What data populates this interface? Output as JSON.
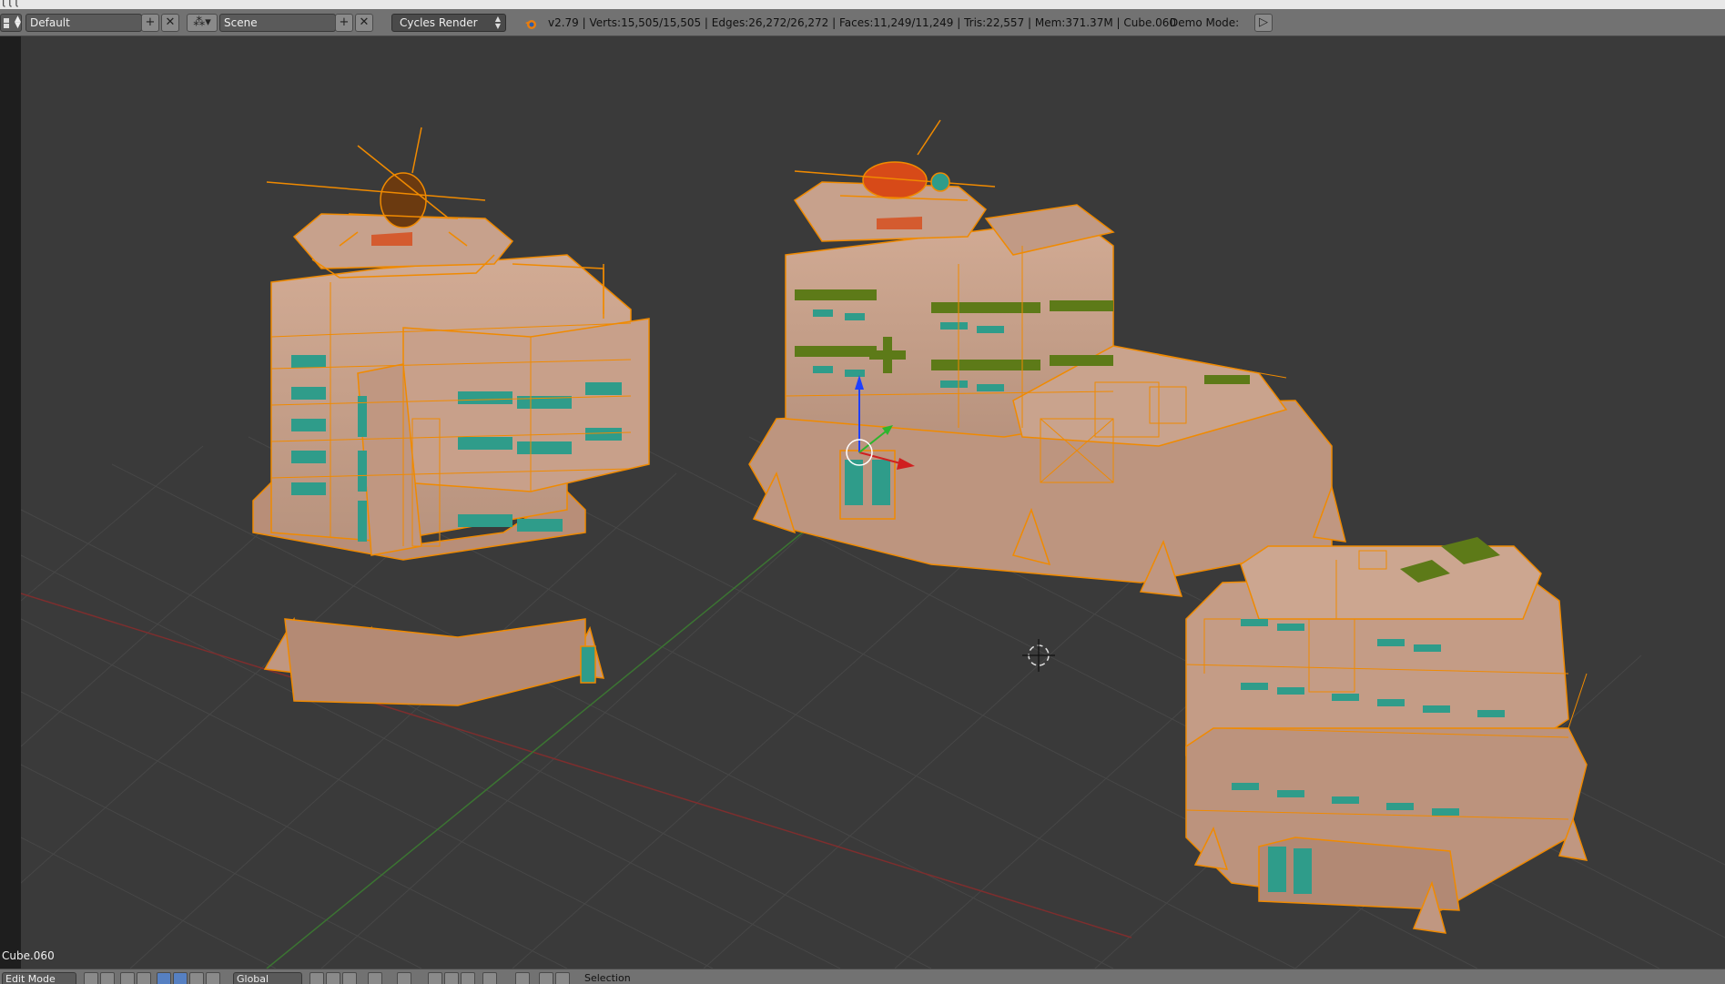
{
  "header": {
    "layout_name": "Default",
    "scene_name": "Scene",
    "render_engine": "Cycles Render",
    "stats": "v2.79 | Verts:15,505/15,505 | Edges:26,272/26,272 | Faces:11,249/11,249 | Tris:22,557 | Mem:371.37M | Cube.060",
    "demo_mode_label": "Demo Mode:"
  },
  "viewport": {
    "active_object_label": "Cube.060",
    "colors": {
      "background": "#3a3a3a",
      "grid": "#4a4a4a",
      "x_axis": "#8a2e2e",
      "y_axis": "#3e7a34",
      "wire": "#f08a00",
      "face": "#c49a84",
      "window": "#2f9c8a",
      "trim": "#5d7a18",
      "heli_red": "#d74a18"
    }
  },
  "footer": {
    "mode": "Edit Mode",
    "orientation": "Global",
    "selection_label": "Selection"
  }
}
